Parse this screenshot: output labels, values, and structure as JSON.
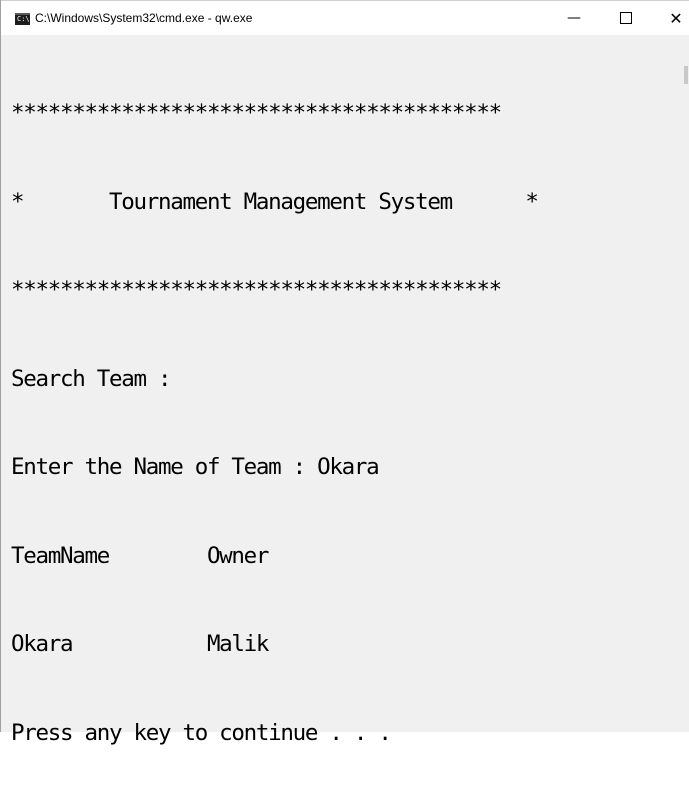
{
  "window": {
    "title": "C:\\Windows\\System32\\cmd.exe - qw.exe",
    "icon": "cmd-icon",
    "icon_text": "C:\\",
    "minimize_glyph": "—",
    "close_glyph": "✕"
  },
  "console": {
    "lines": [
      "****************************************",
      "*       Tournament Management System      *",
      "****************************************",
      "Search Team :",
      "Enter the Name of Team : Okara",
      "TeamName        Owner",
      "Okara           Malik",
      "Press any key to continue . . ."
    ]
  },
  "colors": {
    "console_bg": "#f0f0f0",
    "console_fg": "#000000",
    "titlebar_bg": "#ffffff"
  }
}
